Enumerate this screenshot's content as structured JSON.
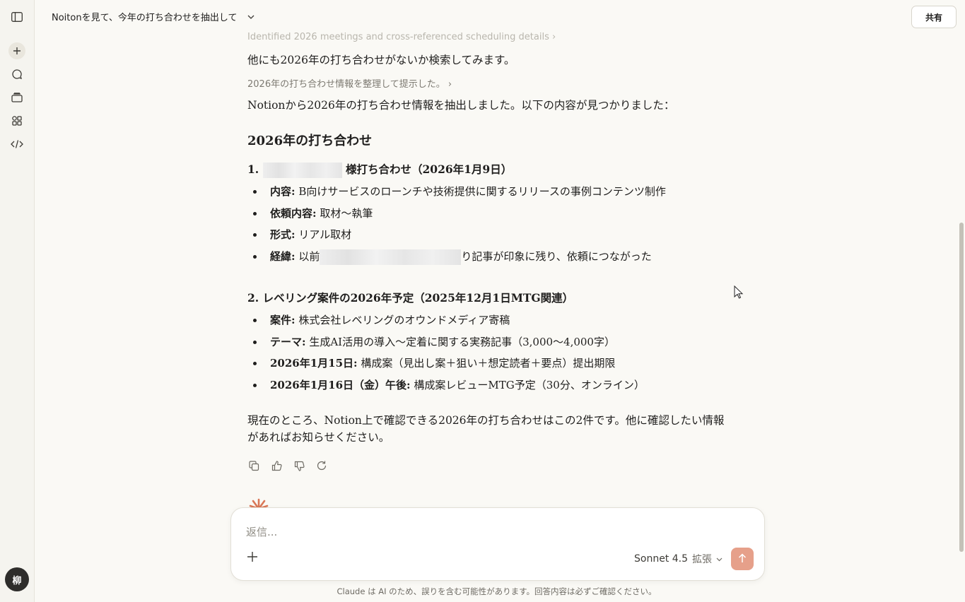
{
  "header": {
    "chat_title": "Noitonを見て、今年の打ち合わせを抽出して",
    "share_label": "共有"
  },
  "sidebar": {
    "icons": [
      "sidebar-toggle-icon",
      "new-chat-icon",
      "chats-icon",
      "projects-icon",
      "artifacts-icon",
      "code-icon"
    ],
    "avatar_initial": "柳"
  },
  "message": {
    "thought_1": "Identified 2026 meetings and cross-referenced scheduling details",
    "para_search": "他にも2026年の打ち合わせがないか検索してみます。",
    "thought_2": "2026年の打ち合わせ情報を整理して提示した。",
    "intro": "Notionから2026年の打ち合わせ情報を抽出しました。以下の内容が見つかりました：",
    "heading": "2026年の打ち合わせ",
    "meeting1": {
      "number": "1.",
      "title_suffix": "様打ち合わせ（2026年1月9日）",
      "items": [
        {
          "label": "内容:",
          "text": "B向けサービスのローンチや技術提供に関するリリースの事例コンテンツ制作"
        },
        {
          "label": "依頼内容:",
          "text": "取材〜執筆"
        },
        {
          "label": "形式:",
          "text": "リアル取材"
        },
        {
          "label": "経緯:",
          "text_before": "以前",
          "text_after": "り記事が印象に残り、依頼につながった"
        }
      ]
    },
    "meeting2": {
      "title": "2. レベリング案件の2026年予定（2025年12月1日MTG関連）",
      "items": [
        {
          "label": "案件:",
          "text": "株式会社レベリングのオウンドメディア寄稿"
        },
        {
          "label": "テーマ:",
          "text": "生成AI活用の導入〜定着に関する実務記事（3,000〜4,000字）"
        },
        {
          "label": "2026年1月15日:",
          "text": "構成案（見出し案＋狙い＋想定読者＋要点）提出期限"
        },
        {
          "label": "2026年1月16日（金）午後:",
          "text": "構成案レビューMTG予定（30分、オンライン）"
        }
      ]
    },
    "closing": "現在のところ、Notion上で確認できる2026年の打ち合わせはこの2件です。他に確認したい情報があればお知らせください。"
  },
  "actions": [
    "copy-icon",
    "thumbs-up-icon",
    "thumbs-down-icon",
    "retry-icon"
  ],
  "composer": {
    "placeholder": "返信...",
    "model": "Sonnet 4.5",
    "mode": "拡張"
  },
  "disclaimer": "Claude は AI のため、誤りを含む可能性があります。回答内容は必ずご確認ください。",
  "colors": {
    "accent": "#d97757",
    "send_button": "#e6a08a",
    "background": "#faf9f5"
  }
}
